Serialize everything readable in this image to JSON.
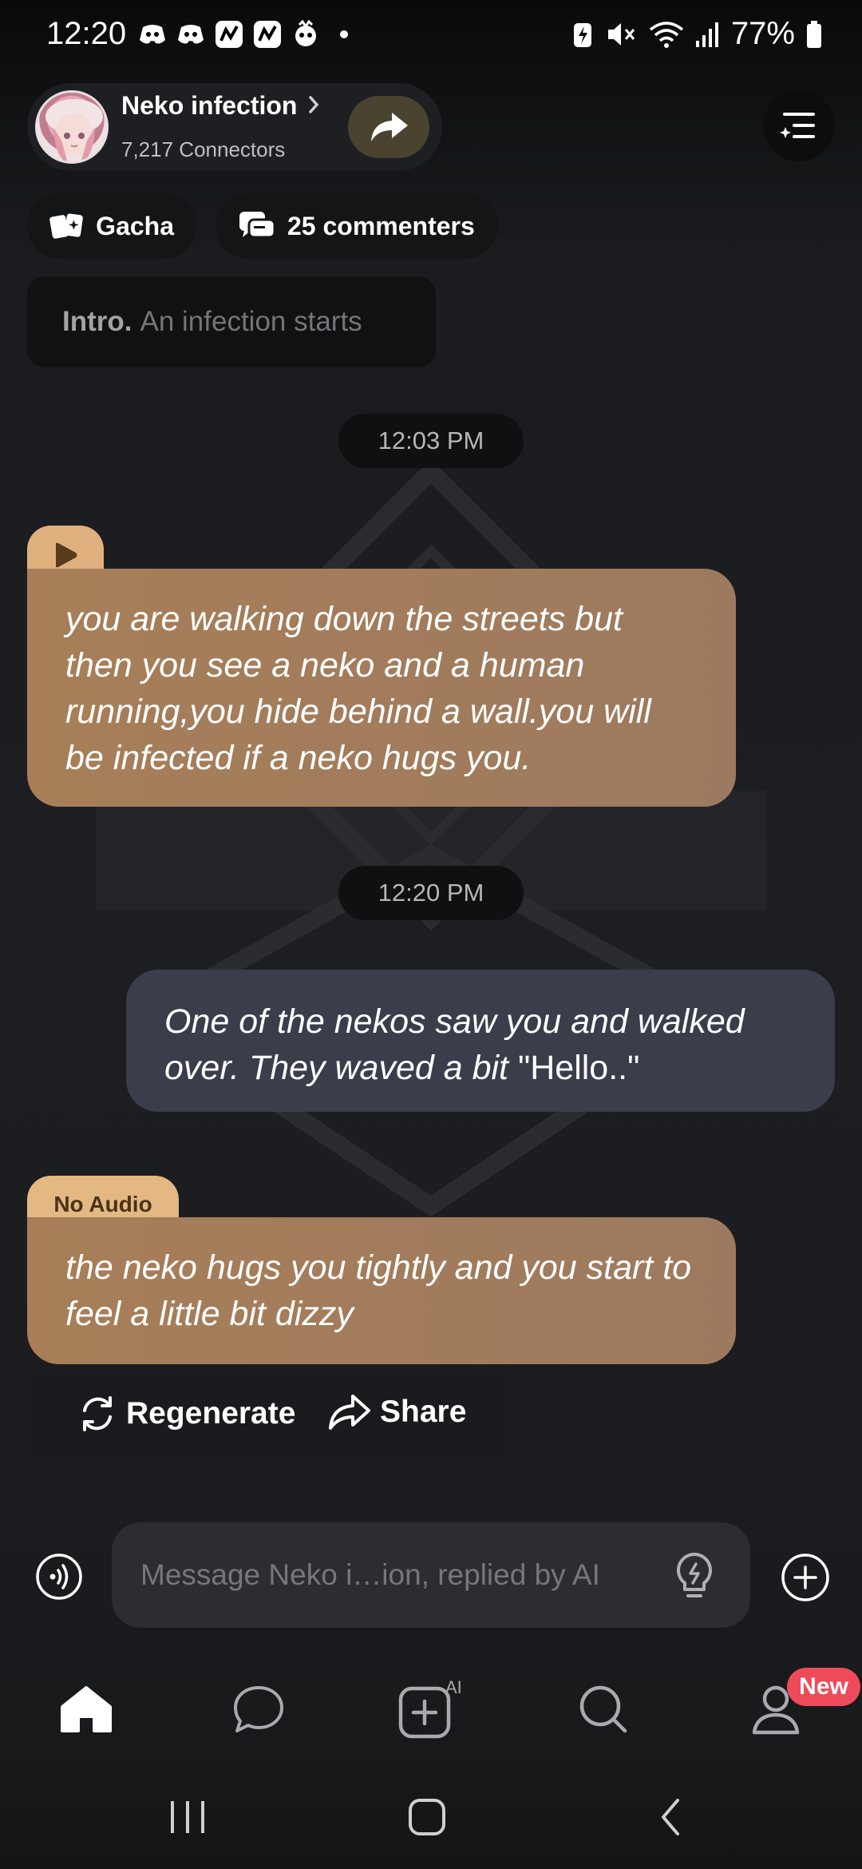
{
  "status_bar": {
    "time": "12:20",
    "battery": "77%"
  },
  "header": {
    "title": "Neko infection",
    "connectors": "7,217 Connectors"
  },
  "chips": {
    "gacha": "Gacha",
    "commenters": "25 commenters"
  },
  "intro": {
    "label": "Intro.",
    "text": "An infection starts"
  },
  "messages": [
    {
      "type": "time",
      "text": "12:03 PM"
    },
    {
      "type": "bot",
      "text": "you are walking down the streets but then you see a neko and a human running,you hide behind a wall.you will be infected if a neko hugs you."
    },
    {
      "type": "time",
      "text": "12:20 PM"
    },
    {
      "type": "user",
      "italic_text": "One of the nekos saw you and walked over. They waved a bit",
      "plain_text": "\"Hello..\""
    },
    {
      "type": "bot",
      "tag": "No Audio",
      "text": "the neko hugs you tightly and you start to feel a little bit dizzy"
    }
  ],
  "actions": {
    "regenerate": "Regenerate",
    "share": "Share"
  },
  "composer": {
    "placeholder": "Message Neko i…ion, replied by AI"
  },
  "bottom_nav": {
    "items": [
      "home-icon",
      "chat-icon",
      "create-ai-icon",
      "search-icon",
      "profile-icon"
    ],
    "badge": "New",
    "active": "home"
  },
  "colors": {
    "bot_bubble": "#a37c5c",
    "user_bubble": "#3a3d4a",
    "badge": "#ee4b5a",
    "audio_tab": "#e0b07f"
  }
}
